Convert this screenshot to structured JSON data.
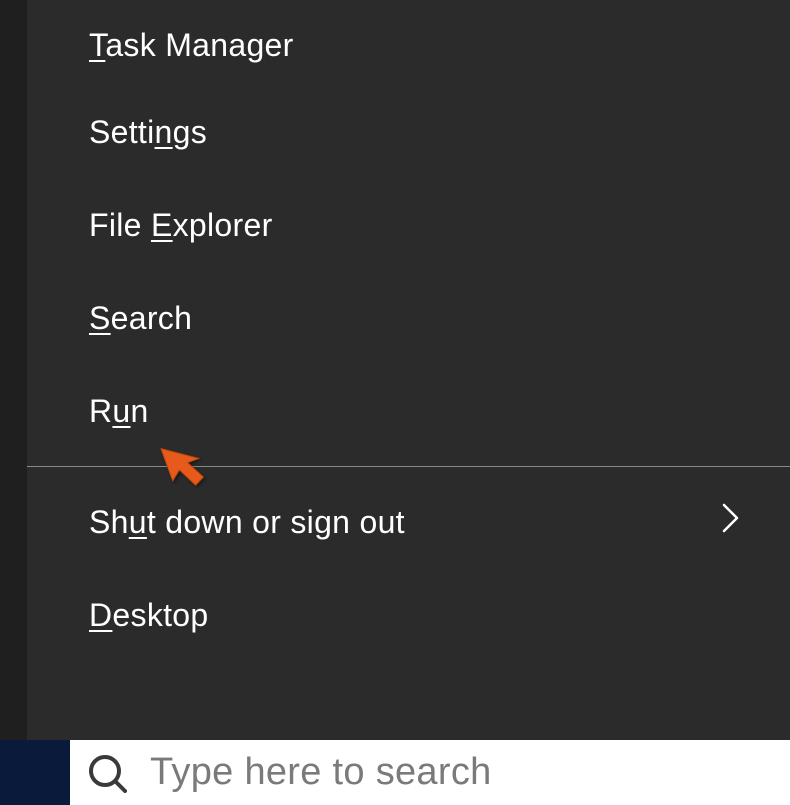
{
  "menu": {
    "items": [
      {
        "pre": "",
        "accel": "T",
        "post": "ask Manager",
        "submenu": false
      },
      {
        "pre": "Setti",
        "accel": "n",
        "post": "gs",
        "submenu": false
      },
      {
        "pre": "File ",
        "accel": "E",
        "post": "xplorer",
        "submenu": false
      },
      {
        "pre": "",
        "accel": "S",
        "post": "earch",
        "submenu": false
      },
      {
        "pre": "R",
        "accel": "u",
        "post": "n",
        "submenu": false
      },
      {
        "pre": "Sh",
        "accel": "u",
        "post": "t down or sign out",
        "submenu": true
      },
      {
        "pre": "",
        "accel": "D",
        "post": "esktop",
        "submenu": false
      }
    ]
  },
  "taskbar": {
    "search_placeholder": "Type here to search"
  }
}
